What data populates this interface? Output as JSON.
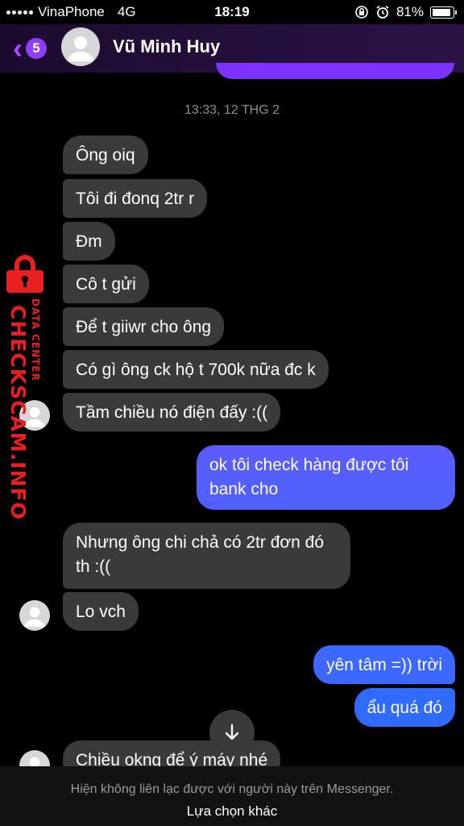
{
  "status_bar": {
    "carrier": "VinaPhone",
    "network": "4G",
    "time": "18:19",
    "battery": "81%"
  },
  "header": {
    "unread_count": "5",
    "contact_name": "Vũ Minh Huy"
  },
  "conversation": {
    "timestamp": "13:33, 12 THG 2",
    "messages": [
      {
        "dir": "in",
        "text": "Ông oiq"
      },
      {
        "dir": "in",
        "text": "Tôi đi đonq 2tr r"
      },
      {
        "dir": "in",
        "text": "Đm"
      },
      {
        "dir": "in",
        "text": "Cô t gửi"
      },
      {
        "dir": "in",
        "text": "Để t giiwr cho ông"
      },
      {
        "dir": "in",
        "text": "Có gì ông ck hộ t 700k nữa đc k"
      },
      {
        "dir": "in",
        "text": "Tầm chiều nó điện đấy :(("
      },
      {
        "dir": "out",
        "text": "ok tôi check hàng được tôi bank cho"
      },
      {
        "dir": "in",
        "text": "Nhưng ông chi chả có 2tr đơn đó th :(("
      },
      {
        "dir": "in",
        "text": "Lo vch"
      },
      {
        "dir": "out",
        "text": "yên tâm =)) trời"
      },
      {
        "dir": "out",
        "text": "ẩu quá đó"
      },
      {
        "dir": "in",
        "text": "Chiều okng để ý máy nhé"
      }
    ]
  },
  "footer": {
    "notice": "Hiện không liên lạc được với người này trên Messenger.",
    "action": "Lựa chọn khác"
  },
  "watermark": {
    "main": "CHECKSCAM.INFO",
    "sub": "DATA CENTER"
  },
  "colors": {
    "incoming_bubble": "#3a3a3c",
    "outgoing_top": "#5b5cff",
    "outgoing_bottom": "#2f6bff",
    "accent": "#8f3dff",
    "watermark": "#e8201f"
  }
}
